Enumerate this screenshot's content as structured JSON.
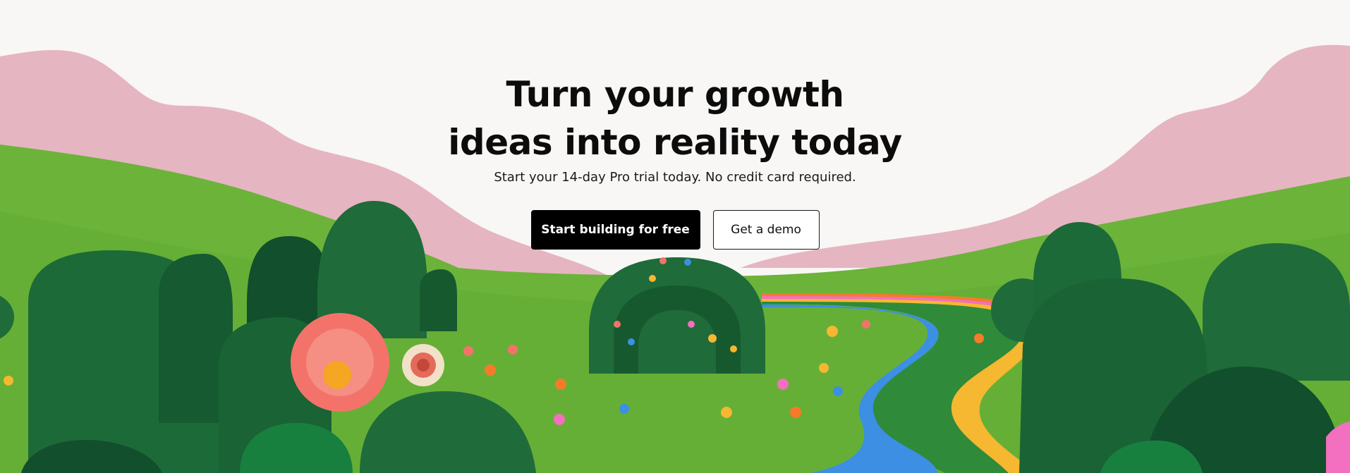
{
  "hero": {
    "headline_line1": "Turn your growth",
    "headline_line2": "ideas into reality today",
    "subline": "Start your 14-day Pro trial today. No credit card required.",
    "primary_cta": "Start building for free",
    "secondary_cta": "Get a demo"
  },
  "colors": {
    "background": "#f8f7f5",
    "hills_pink": "#e6b5c2",
    "grass": "#6cb33a",
    "grass_dark": "#4e9a2a",
    "bush": "#1f6b3a",
    "bush_dark": "#124f2c",
    "path_blue": "#3c8fe3",
    "path_pink": "#f36fbf",
    "path_orange": "#f57b2a",
    "path_yellow": "#f6b731",
    "path_green": "#2f8a3a",
    "flower_pink": "#f3736a",
    "flower_center": "#f5a623",
    "primary_button": "#000000",
    "secondary_button": "#ffffff"
  },
  "illustration": {
    "name": "garden-landscape-illustration",
    "elements": [
      "pink-hills",
      "green-meadow",
      "rainbow-path",
      "hedge-arch",
      "topiary-bushes",
      "daisy-flower",
      "small-flowers"
    ]
  }
}
